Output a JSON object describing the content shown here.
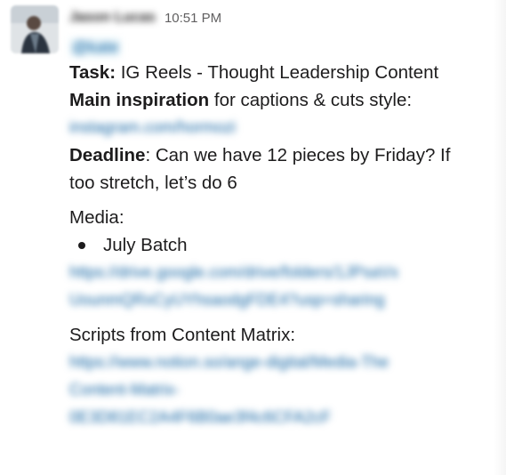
{
  "message": {
    "sender_name": "Jason Lucas",
    "timestamp": "10:51 PM",
    "mention": "@kate",
    "task_label": "Task:",
    "task_value": "IG Reels - Thought Leadership Content",
    "inspiration_label": "Main inspiration",
    "inspiration_value": "for captions & cuts style:",
    "inspiration_link": "instagram.com/hormozi",
    "deadline_label": "Deadline",
    "deadline_line1": ": Can we have 12 pieces by Friday? If",
    "deadline_line2": "too stretch, let’s do 6",
    "media_label": "Media:",
    "media_items": [
      "July Batch"
    ],
    "media_link_line1": "https://drive.google.com/drive/folders/1JPsaVx",
    "media_link_line2": "UounmQRxCyUYhsaodgFDE4?usp=sharing",
    "scripts_label": "Scripts from Content Matrix:",
    "scripts_link_line1": "https://www.notion.so/ange-digital/Media-The",
    "scripts_link_line2": "Content-Matrix-",
    "scripts_link_line3": "0E3D81EC2A4F6B0ae3f4c6CFA2cF"
  },
  "colors": {
    "text": "#1d1c1d",
    "timestamp": "#616061",
    "link": "#1264a3",
    "mention_bg": "#e8f5fa"
  }
}
